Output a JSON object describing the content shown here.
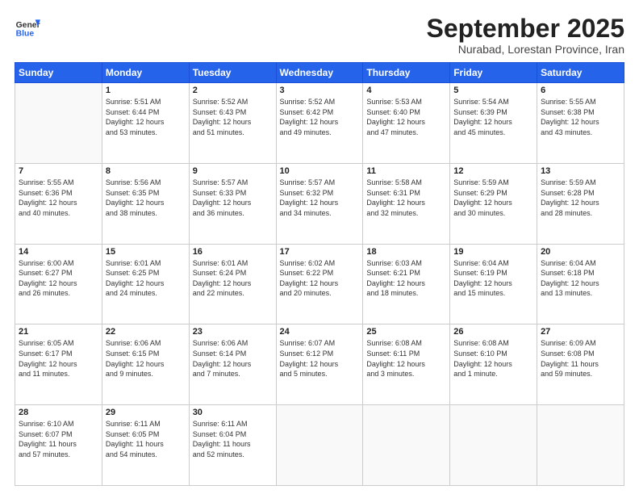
{
  "logo": {
    "general": "General",
    "blue": "Blue"
  },
  "header": {
    "month": "September 2025",
    "location": "Nurabad, Lorestan Province, Iran"
  },
  "weekdays": [
    "Sunday",
    "Monday",
    "Tuesday",
    "Wednesday",
    "Thursday",
    "Friday",
    "Saturday"
  ],
  "weeks": [
    [
      {
        "day": "",
        "info": ""
      },
      {
        "day": "1",
        "info": "Sunrise: 5:51 AM\nSunset: 6:44 PM\nDaylight: 12 hours\nand 53 minutes."
      },
      {
        "day": "2",
        "info": "Sunrise: 5:52 AM\nSunset: 6:43 PM\nDaylight: 12 hours\nand 51 minutes."
      },
      {
        "day": "3",
        "info": "Sunrise: 5:52 AM\nSunset: 6:42 PM\nDaylight: 12 hours\nand 49 minutes."
      },
      {
        "day": "4",
        "info": "Sunrise: 5:53 AM\nSunset: 6:40 PM\nDaylight: 12 hours\nand 47 minutes."
      },
      {
        "day": "5",
        "info": "Sunrise: 5:54 AM\nSunset: 6:39 PM\nDaylight: 12 hours\nand 45 minutes."
      },
      {
        "day": "6",
        "info": "Sunrise: 5:55 AM\nSunset: 6:38 PM\nDaylight: 12 hours\nand 43 minutes."
      }
    ],
    [
      {
        "day": "7",
        "info": "Sunrise: 5:55 AM\nSunset: 6:36 PM\nDaylight: 12 hours\nand 40 minutes."
      },
      {
        "day": "8",
        "info": "Sunrise: 5:56 AM\nSunset: 6:35 PM\nDaylight: 12 hours\nand 38 minutes."
      },
      {
        "day": "9",
        "info": "Sunrise: 5:57 AM\nSunset: 6:33 PM\nDaylight: 12 hours\nand 36 minutes."
      },
      {
        "day": "10",
        "info": "Sunrise: 5:57 AM\nSunset: 6:32 PM\nDaylight: 12 hours\nand 34 minutes."
      },
      {
        "day": "11",
        "info": "Sunrise: 5:58 AM\nSunset: 6:31 PM\nDaylight: 12 hours\nand 32 minutes."
      },
      {
        "day": "12",
        "info": "Sunrise: 5:59 AM\nSunset: 6:29 PM\nDaylight: 12 hours\nand 30 minutes."
      },
      {
        "day": "13",
        "info": "Sunrise: 5:59 AM\nSunset: 6:28 PM\nDaylight: 12 hours\nand 28 minutes."
      }
    ],
    [
      {
        "day": "14",
        "info": "Sunrise: 6:00 AM\nSunset: 6:27 PM\nDaylight: 12 hours\nand 26 minutes."
      },
      {
        "day": "15",
        "info": "Sunrise: 6:01 AM\nSunset: 6:25 PM\nDaylight: 12 hours\nand 24 minutes."
      },
      {
        "day": "16",
        "info": "Sunrise: 6:01 AM\nSunset: 6:24 PM\nDaylight: 12 hours\nand 22 minutes."
      },
      {
        "day": "17",
        "info": "Sunrise: 6:02 AM\nSunset: 6:22 PM\nDaylight: 12 hours\nand 20 minutes."
      },
      {
        "day": "18",
        "info": "Sunrise: 6:03 AM\nSunset: 6:21 PM\nDaylight: 12 hours\nand 18 minutes."
      },
      {
        "day": "19",
        "info": "Sunrise: 6:04 AM\nSunset: 6:19 PM\nDaylight: 12 hours\nand 15 minutes."
      },
      {
        "day": "20",
        "info": "Sunrise: 6:04 AM\nSunset: 6:18 PM\nDaylight: 12 hours\nand 13 minutes."
      }
    ],
    [
      {
        "day": "21",
        "info": "Sunrise: 6:05 AM\nSunset: 6:17 PM\nDaylight: 12 hours\nand 11 minutes."
      },
      {
        "day": "22",
        "info": "Sunrise: 6:06 AM\nSunset: 6:15 PM\nDaylight: 12 hours\nand 9 minutes."
      },
      {
        "day": "23",
        "info": "Sunrise: 6:06 AM\nSunset: 6:14 PM\nDaylight: 12 hours\nand 7 minutes."
      },
      {
        "day": "24",
        "info": "Sunrise: 6:07 AM\nSunset: 6:12 PM\nDaylight: 12 hours\nand 5 minutes."
      },
      {
        "day": "25",
        "info": "Sunrise: 6:08 AM\nSunset: 6:11 PM\nDaylight: 12 hours\nand 3 minutes."
      },
      {
        "day": "26",
        "info": "Sunrise: 6:08 AM\nSunset: 6:10 PM\nDaylight: 12 hours\nand 1 minute."
      },
      {
        "day": "27",
        "info": "Sunrise: 6:09 AM\nSunset: 6:08 PM\nDaylight: 11 hours\nand 59 minutes."
      }
    ],
    [
      {
        "day": "28",
        "info": "Sunrise: 6:10 AM\nSunset: 6:07 PM\nDaylight: 11 hours\nand 57 minutes."
      },
      {
        "day": "29",
        "info": "Sunrise: 6:11 AM\nSunset: 6:05 PM\nDaylight: 11 hours\nand 54 minutes."
      },
      {
        "day": "30",
        "info": "Sunrise: 6:11 AM\nSunset: 6:04 PM\nDaylight: 11 hours\nand 52 minutes."
      },
      {
        "day": "",
        "info": ""
      },
      {
        "day": "",
        "info": ""
      },
      {
        "day": "",
        "info": ""
      },
      {
        "day": "",
        "info": ""
      }
    ]
  ]
}
